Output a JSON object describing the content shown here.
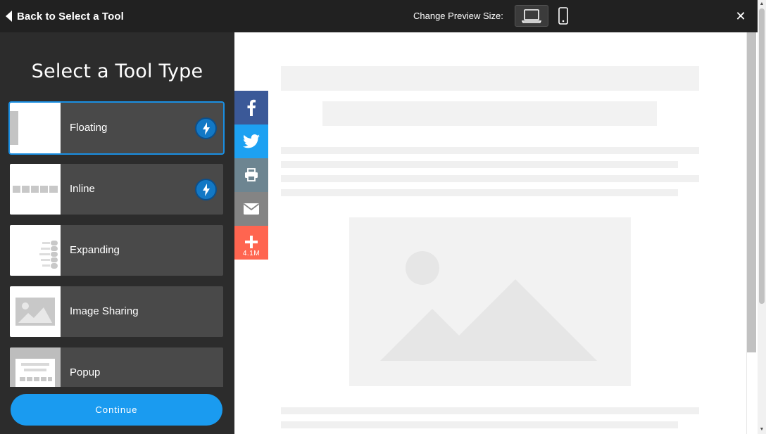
{
  "topbar": {
    "back_label": "Back to Select a Tool",
    "preview_label": "Change Preview Size:",
    "close_glyph": "✕"
  },
  "panel": {
    "title": "Select a Tool Type",
    "tools": [
      {
        "label": "Floating",
        "icon": "floating-thumbnail",
        "fast": true,
        "selected": true
      },
      {
        "label": "Inline",
        "icon": "inline-thumbnail",
        "fast": true,
        "selected": false
      },
      {
        "label": "Expanding",
        "icon": "expanding-thumbnail",
        "fast": false,
        "selected": false
      },
      {
        "label": "Image Sharing",
        "icon": "image-sharing-thumbnail",
        "fast": false,
        "selected": false
      },
      {
        "label": "Popup",
        "icon": "popup-thumbnail",
        "fast": false,
        "selected": false
      }
    ],
    "continue_label": "Continue"
  },
  "share_bar": {
    "buttons": [
      {
        "icon": "facebook-icon",
        "color": "#3b5998"
      },
      {
        "icon": "twitter-icon",
        "color": "#1da1f2"
      },
      {
        "icon": "print-icon",
        "color": "#6d8591"
      },
      {
        "icon": "email-icon",
        "color": "#848484"
      },
      {
        "icon": "plus-icon",
        "color": "#ff6550"
      }
    ],
    "count": "4.1M"
  },
  "colors": {
    "accent": "#1a9bf0",
    "topbar": "#212121",
    "panel": "#2c2c2c",
    "tool_bg": "#494949",
    "bolt": "#1278c5"
  }
}
